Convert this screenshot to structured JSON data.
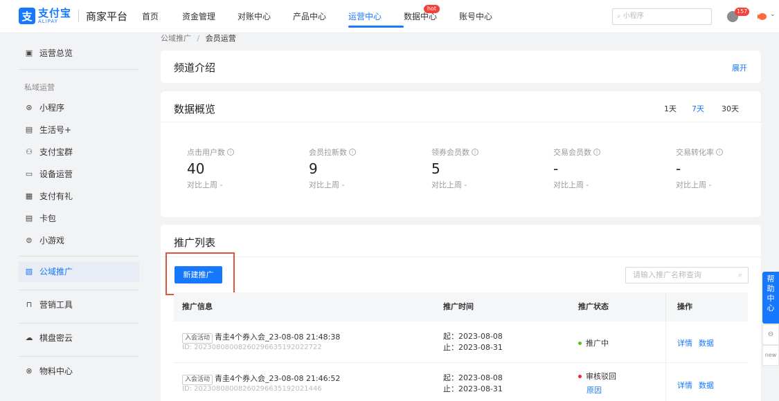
{
  "header": {
    "logo_mark": "支",
    "logo_cn": "支付宝",
    "logo_en": "ALIPAY",
    "platform": "商家平台",
    "nav": [
      {
        "label": "首页"
      },
      {
        "label": "资金管理"
      },
      {
        "label": "对账中心"
      },
      {
        "label": "产品中心"
      },
      {
        "label": "运营中心",
        "active": true
      },
      {
        "label": "数据中心",
        "badge": "hot"
      },
      {
        "label": "账号中心"
      }
    ],
    "search_placeholder": "小程序",
    "notification_count": "157"
  },
  "sidebar": {
    "overview": "运营总览",
    "group_label": "私域运营",
    "items": [
      "小程序",
      "生活号+",
      "支付宝群",
      "设备运营",
      "支付有礼",
      "卡包",
      "小游戏"
    ],
    "public_promo": "公域推广",
    "marketing_tools": "营销工具",
    "cloud": "棋盘密云",
    "materials": "物料中心"
  },
  "breadcrumb": {
    "parent": "公域推广",
    "separator": "/",
    "current": "会员运营"
  },
  "intro": {
    "title": "频道介绍",
    "expand": "展开"
  },
  "overview": {
    "title": "数据概览",
    "ranges": [
      "1天",
      "7天",
      "30天"
    ],
    "active_range": "7天",
    "metrics": [
      {
        "label": "点击用户数",
        "value": "40",
        "compare": "对比上周 -"
      },
      {
        "label": "会员拉新数",
        "value": "9",
        "compare": "对比上周 -"
      },
      {
        "label": "领券会员数",
        "value": "5",
        "compare": "对比上周 -"
      },
      {
        "label": "交易会员数",
        "value": "-",
        "compare": "对比上周 -"
      },
      {
        "label": "交易转化率",
        "value": "-",
        "compare": "对比上周 -"
      }
    ]
  },
  "promo_list": {
    "title": "推广列表",
    "new_button": "新建推广",
    "search_placeholder": "请输入推广名称查询",
    "columns": [
      "推广信息",
      "推广时间",
      "推广状态",
      "操作"
    ],
    "rows": [
      {
        "tag": "入会活动",
        "name": "青圭4个券入会_23-08-08 21:48:38",
        "id": "ID: 20230808008260296635192022722",
        "start": "起：2023-08-08",
        "end": "止：2023-08-31",
        "status": "推广中",
        "status_color": "#52c41a",
        "actions": [
          "详情",
          "数据"
        ]
      },
      {
        "tag": "入会活动",
        "name": "青圭4个券入会_23-08-08 21:46:52",
        "id": "ID: 20230808008260296635192021446",
        "start": "起：2023-08-08",
        "end": "止：2023-08-31",
        "status": "审核驳回",
        "status_color": "#f5222d",
        "reason": "原因",
        "actions": [
          "详情",
          "数据"
        ]
      }
    ]
  },
  "help": {
    "label": "帮助中心",
    "new": "new"
  }
}
